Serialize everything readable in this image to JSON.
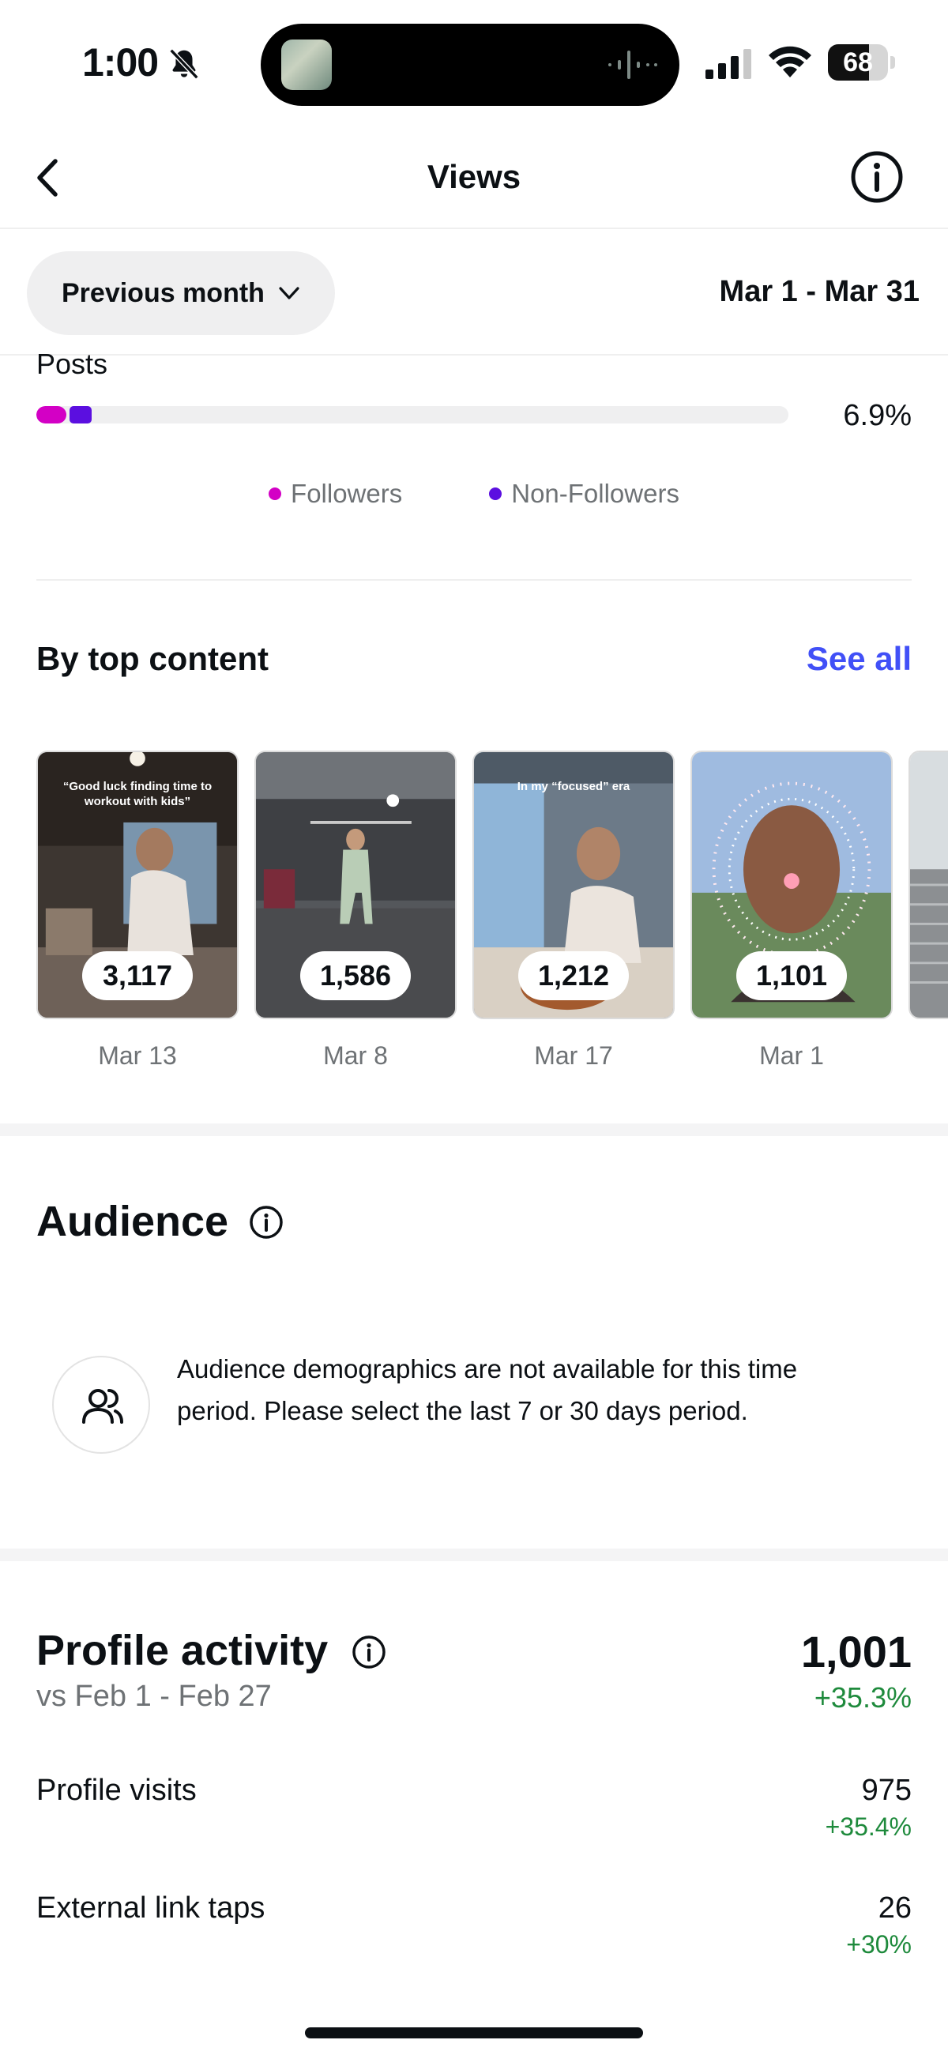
{
  "status_bar": {
    "time": "1:00",
    "battery": "68",
    "battery_level": 0.68
  },
  "header": {
    "title": "Views"
  },
  "filter": {
    "period": "Previous month",
    "date_range": "Mar 1 - Mar 31"
  },
  "posts": {
    "label": "Posts",
    "percent": "6.9%",
    "followers_fraction": 0.04,
    "non_followers_fraction": 0.029
  },
  "legend": [
    {
      "label": "Followers",
      "color": "#d300c5"
    },
    {
      "label": "Non-Followers",
      "color": "#5b0fe0"
    }
  ],
  "top_content": {
    "title": "By top content",
    "see_all": "See all",
    "items": [
      {
        "count": "3,117",
        "date": "Mar 13",
        "caption": "“Good luck finding time to workout with kids”"
      },
      {
        "count": "1,586",
        "date": "Mar 8",
        "caption": ""
      },
      {
        "count": "1,212",
        "date": "Mar 17",
        "caption": "In my “focused” era"
      },
      {
        "count": "1,101",
        "date": "Mar 1",
        "caption": ""
      }
    ]
  },
  "audience": {
    "title": "Audience",
    "message": "Audience demographics are not available for this time period. Please select the last 7 or 30 days period."
  },
  "profile_activity": {
    "title": "Profile activity",
    "compare": "vs Feb 1 - Feb 27",
    "total": "1,001",
    "total_change": "+35.3%",
    "metrics": [
      {
        "label": "Profile visits",
        "value": "975",
        "change": "+35.4%"
      },
      {
        "label": "External link taps",
        "value": "26",
        "change": "+30%"
      }
    ]
  },
  "colors": {
    "accent": "#4150f7",
    "positive": "#1e8a3c",
    "followers": "#d300c5",
    "non_followers": "#5b0fe0"
  }
}
